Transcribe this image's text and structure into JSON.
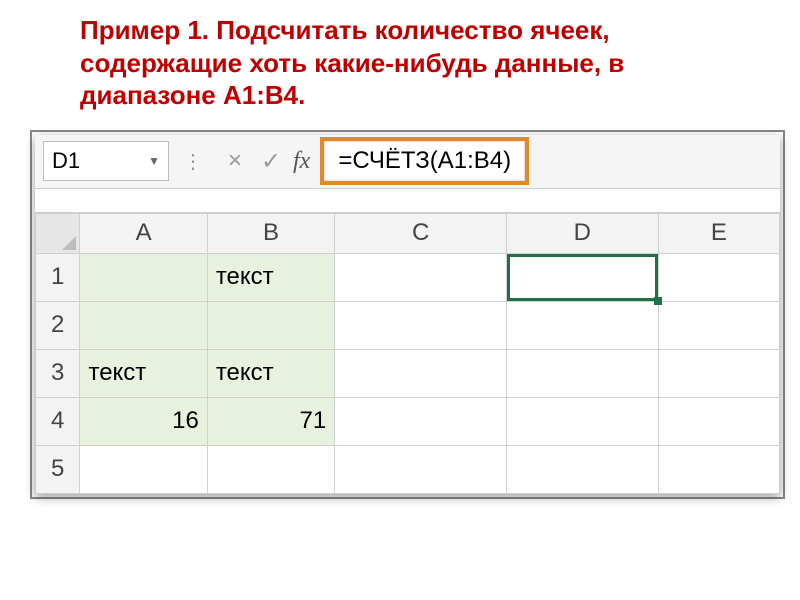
{
  "title": "Пример 1. Подсчитать количество ячеек, содержащие хоть какие-нибудь данные, в диапазоне A1:B4.",
  "formulaBar": {
    "nameBox": "D1",
    "cancel": "×",
    "confirm": "✓",
    "fx": "fx",
    "formula": "=СЧЁТЗ(A1:B4)"
  },
  "columns": {
    "A": "A",
    "B": "B",
    "C": "C",
    "D": "D",
    "E": "E"
  },
  "rows": {
    "r1": {
      "n": "1",
      "A": "",
      "B": "текст",
      "C": "",
      "D": "",
      "E": ""
    },
    "r2": {
      "n": "2",
      "A": "",
      "B": "",
      "C": "",
      "D": "",
      "E": ""
    },
    "r3": {
      "n": "3",
      "A": "текст",
      "B": "текст",
      "C": "",
      "D": "",
      "E": ""
    },
    "r4": {
      "n": "4",
      "A": "16",
      "B": "71",
      "C": "",
      "D": "",
      "E": ""
    },
    "r5": {
      "n": "5",
      "A": "",
      "B": "",
      "C": "",
      "D": "",
      "E": ""
    }
  }
}
